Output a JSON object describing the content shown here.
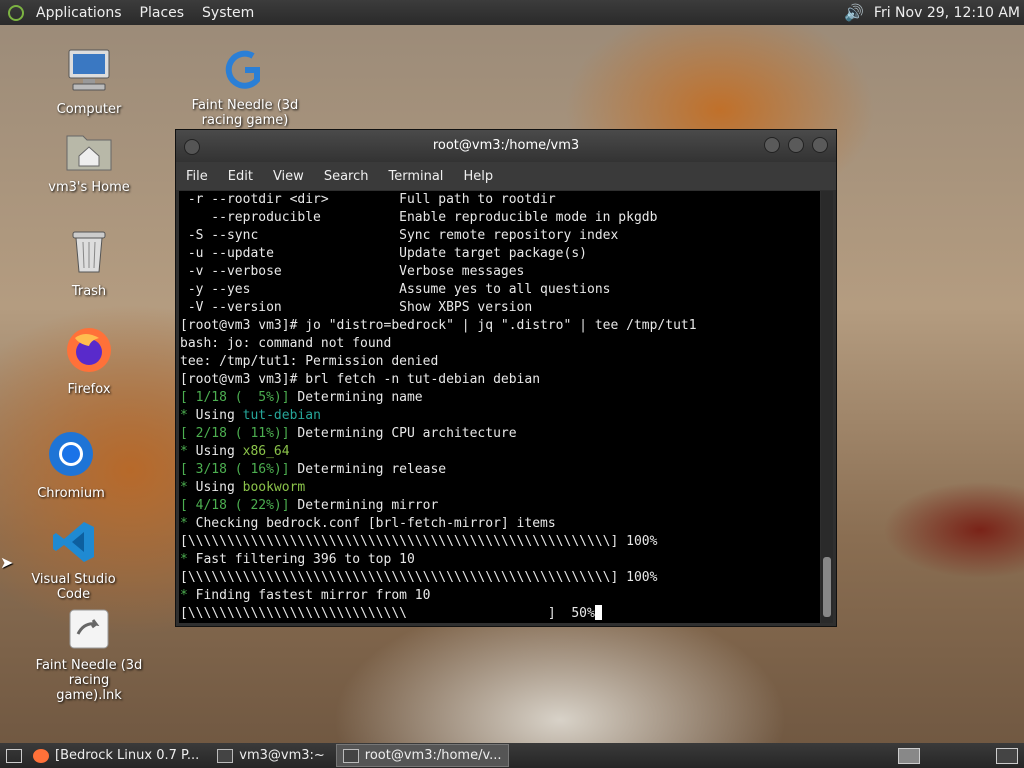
{
  "top_panel": {
    "menus": [
      "Applications",
      "Places",
      "System"
    ],
    "clock": "Fri Nov 29, 12:10 AM"
  },
  "desktop_icons": [
    {
      "label": "Computer",
      "icon": "computer-icon"
    },
    {
      "label": "Faint Needle (3d racing game)",
      "icon": "game-icon"
    },
    {
      "label": "vm3's Home",
      "icon": "home-folder-icon"
    },
    {
      "label": "Trash",
      "icon": "trash-icon"
    },
    {
      "label": "Firefox",
      "icon": "firefox-icon"
    },
    {
      "label": "Chromium",
      "icon": "chromium-icon"
    },
    {
      "label": "Visual Studio Code",
      "icon": "vscode-icon"
    },
    {
      "label": "Faint Needle (3d racing game).lnk",
      "icon": "shortcut-icon"
    }
  ],
  "terminal": {
    "title": "root@vm3:/home/vm3",
    "menu": [
      "File",
      "Edit",
      "View",
      "Search",
      "Terminal",
      "Help"
    ],
    "lines": [
      [
        {
          "t": " -r --rootdir <dir>         Full path to rootdir"
        }
      ],
      [
        {
          "t": "    --reproducible          Enable reproducible mode in pkgdb"
        }
      ],
      [
        {
          "t": " -S --sync                  Sync remote repository index"
        }
      ],
      [
        {
          "t": " -u --update                Update target package(s)"
        }
      ],
      [
        {
          "t": " -v --verbose               Verbose messages"
        }
      ],
      [
        {
          "t": " -y --yes                   Assume yes to all questions"
        }
      ],
      [
        {
          "t": " -V --version               Show XBPS version"
        }
      ],
      [
        {
          "t": "[root@vm3 vm3]# jo \"distro=bedrock\" | jq \".distro\" | tee /tmp/tut1"
        }
      ],
      [
        {
          "t": "bash: jo: command not found"
        }
      ],
      [
        {
          "t": "tee: /tmp/tut1: Permission denied"
        }
      ],
      [
        {
          "t": "[root@vm3 vm3]# brl fetch -n tut-debian debian"
        }
      ],
      [
        {
          "t": "[ 1/18 (  5%)]",
          "c": "green"
        },
        {
          "t": " Determining name"
        }
      ],
      [
        {
          "t": "* ",
          "c": "green"
        },
        {
          "t": "Using "
        },
        {
          "t": "tut-debian",
          "c": "teal"
        }
      ],
      [
        {
          "t": "[ 2/18 ( 11%)]",
          "c": "green"
        },
        {
          "t": " Determining CPU architecture"
        }
      ],
      [
        {
          "t": "* ",
          "c": "green"
        },
        {
          "t": "Using "
        },
        {
          "t": "x86_64",
          "c": "ygreen"
        }
      ],
      [
        {
          "t": "[ 3/18 ( 16%)]",
          "c": "green"
        },
        {
          "t": " Determining release"
        }
      ],
      [
        {
          "t": "* ",
          "c": "green"
        },
        {
          "t": "Using "
        },
        {
          "t": "bookworm",
          "c": "ygreen"
        }
      ],
      [
        {
          "t": "[ 4/18 ( 22%)]",
          "c": "green"
        },
        {
          "t": " Determining mirror"
        }
      ],
      [
        {
          "t": "* ",
          "c": "green"
        },
        {
          "t": "Checking bedrock.conf [brl-fetch-mirror] items"
        }
      ],
      [
        {
          "t": "[\\\\\\\\\\\\\\\\\\\\\\\\\\\\\\\\\\\\\\\\\\\\\\\\\\\\\\\\\\\\\\\\\\\\\\\\\\\\\\\\\\\\\\\\\\\\\\\\\\\\\\\\\\\\] 100%"
        }
      ],
      [
        {
          "t": "* ",
          "c": "green"
        },
        {
          "t": "Fast filtering 396 to top 10"
        }
      ],
      [
        {
          "t": "[\\\\\\\\\\\\\\\\\\\\\\\\\\\\\\\\\\\\\\\\\\\\\\\\\\\\\\\\\\\\\\\\\\\\\\\\\\\\\\\\\\\\\\\\\\\\\\\\\\\\\\\\\\\\] 100%"
        }
      ],
      [
        {
          "t": "* ",
          "c": "green"
        },
        {
          "t": "Finding fastest mirror from 10"
        }
      ],
      [
        {
          "t": "[\\\\\\\\\\\\\\\\\\\\\\\\\\\\\\\\\\\\\\\\\\\\\\\\\\\\\\\\                  ]  50%"
        }
      ]
    ]
  },
  "taskbar": {
    "tasks": [
      {
        "label": "[Bedrock Linux 0.7 P...",
        "icon": "firefox-icon",
        "active": false
      },
      {
        "label": "vm3@vm3:~",
        "icon": "terminal-icon",
        "active": false
      },
      {
        "label": "root@vm3:/home/v...",
        "icon": "terminal-icon",
        "active": true
      }
    ]
  }
}
